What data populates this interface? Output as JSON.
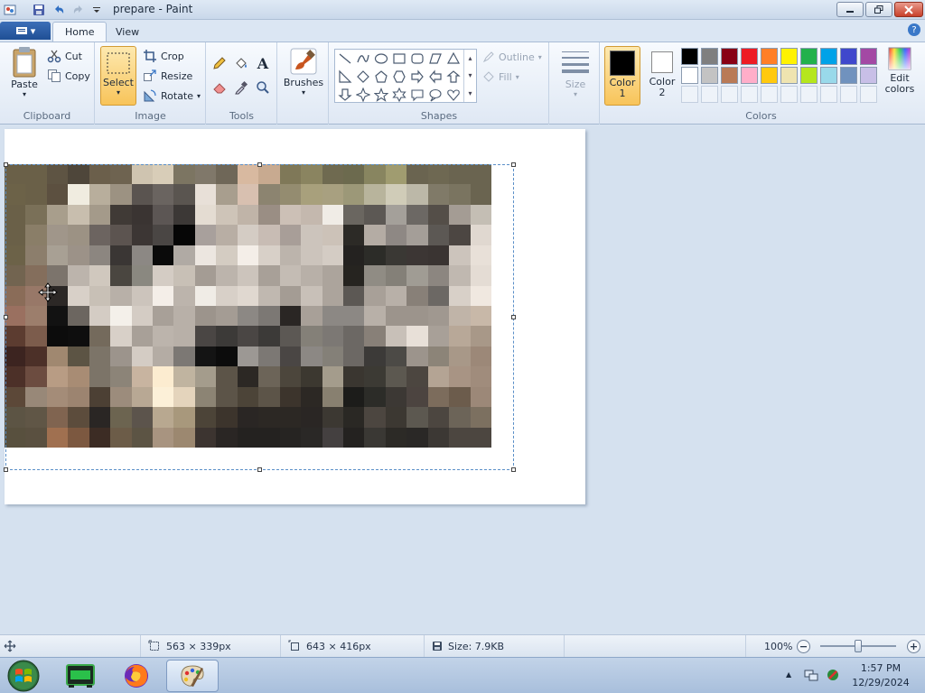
{
  "window": {
    "title": "prepare - Paint"
  },
  "tabs": [
    {
      "label": "Home"
    },
    {
      "label": "View"
    }
  ],
  "clipboard": {
    "paste": "Paste",
    "cut": "Cut",
    "copy": "Copy",
    "label": "Clipboard"
  },
  "image": {
    "select": "Select",
    "crop": "Crop",
    "resize": "Resize",
    "rotate": "Rotate",
    "label": "Image"
  },
  "tools": {
    "label": "Tools"
  },
  "brushes": {
    "label": "Brushes"
  },
  "shapes": {
    "outline": "Outline",
    "fill": "Fill",
    "label": "Shapes"
  },
  "size": {
    "label": "Size"
  },
  "colors": {
    "color1": "Color 1",
    "color2": "Color 2",
    "edit": "Edit colors",
    "label": "Colors",
    "color1_value": "#000000",
    "color2_value": "#ffffff",
    "palette_row1": [
      "#000000",
      "#7f7f7f",
      "#880015",
      "#ed1c24",
      "#ff7f27",
      "#fff200",
      "#22b14c",
      "#00a2e8",
      "#3f48cc",
      "#a349a4"
    ],
    "palette_row2": [
      "#ffffff",
      "#c3c3c3",
      "#b97a57",
      "#ffaec9",
      "#ffc90e",
      "#efe4b0",
      "#b5e61d",
      "#99d9ea",
      "#7092be",
      "#c8bfe7"
    ]
  },
  "status": {
    "selection_size": "563 × 339px",
    "canvas_size": "643 × 416px",
    "file_size": "Size: 7.9KB",
    "zoom": "100%",
    "zoom_level": 0.5
  },
  "taskbar": {
    "time": "1:57 PM",
    "date": "12/29/2024"
  },
  "image_pixels": [
    [
      "#6a6048",
      "#6a6048",
      "#5e5443",
      "#4e463a",
      "#6b5f4b",
      "#6e6350",
      "#cfc4b0",
      "#d8cdb8",
      "#7c7562",
      "#80786a",
      "#6f6758",
      "#d8b9a0",
      "#c8aa90",
      "#7f7858",
      "#8a8460",
      "#6f6a50",
      "#6c6a4e",
      "#888560",
      "#a09c70",
      "#6a6450",
      "#6e6852",
      "#6a6450",
      "#6a6450"
    ],
    [
      "#6c6248",
      "#6a6048",
      "#5c5040",
      "#f0ece0",
      "#b8ae9c",
      "#9c9282",
      "#5a5450",
      "#6a6460",
      "#5a5550",
      "#e8e0d8",
      "#a89e8e",
      "#d8c0b0",
      "#8c8470",
      "#948c70",
      "#a8a07c",
      "#a8a080",
      "#9c9878",
      "#b8b49c",
      "#d0ccb8",
      "#bcb8a8",
      "#807a68",
      "#7a7460",
      "#6a6450"
    ],
    [
      "#6a6048",
      "#7a7058",
      "#a89e8c",
      "#c8beae",
      "#a49a8a",
      "#403a36",
      "#3a3432",
      "#5c5654",
      "#3c3836",
      "#e4dcd2",
      "#cec4b8",
      "#c0b4a8",
      "#9a8e84",
      "#ccc0b6",
      "#c4b8ae",
      "#f0ece6",
      "#6a6660",
      "#5c5854",
      "#a4a09a",
      "#6c6864",
      "#544e48",
      "#a49c94",
      "#c4beb4"
    ],
    [
      "#6a6048",
      "#8a7e68",
      "#a0968a",
      "#9c9284",
      "#6c6460",
      "#5c5450",
      "#3c3634",
      "#4a4644",
      "#060606",
      "#a8a09c",
      "#b8aea4",
      "#d4ccc4",
      "#c8bcb4",
      "#a89e98",
      "#ccc4bc",
      "#ccc2b8",
      "#2c2a26",
      "#b4aca4",
      "#8e8884",
      "#a49e98",
      "#5c5854",
      "#4c4642",
      "#e0d8d0"
    ],
    [
      "#6c6248",
      "#8c7e6c",
      "#a8a094",
      "#9c9288",
      "#8c8680",
      "#3a3634",
      "#8c8884",
      "#0a0a0a",
      "#b0aaa4",
      "#ece6e0",
      "#d4ccc2",
      "#f4eee8",
      "#d8d0c8",
      "#bcb4ac",
      "#ccc4bc",
      "#d4ccc4",
      "#242220",
      "#2c2c28",
      "#3a3834",
      "#3c3634",
      "#3a3432",
      "#ccc4bc",
      "#e8e0d8"
    ],
    [
      "#726450",
      "#846e5c",
      "#7c746c",
      "#bcb4ac",
      "#d0c8be",
      "#4a4640",
      "#8a8880",
      "#d4ccc4",
      "#c8c0b6",
      "#a49c94",
      "#bcb4ac",
      "#ccc4bc",
      "#a8a098",
      "#c4bcb4",
      "#b8b0a8",
      "#aca49c",
      "#262420",
      "#908c84",
      "#848078",
      "#a09c94",
      "#8c8680",
      "#c0b8b0",
      "#e4dcd4"
    ],
    [
      "#8a6c58",
      "#987868",
      "#2c2826",
      "#d8d0c8",
      "#c8c0b6",
      "#b8b0a8",
      "#ccc4bc",
      "#f4eee8",
      "#bcb4ac",
      "#f0ece6",
      "#d8d0c8",
      "#e0d8d0",
      "#c0b8b0",
      "#a49c94",
      "#c8c0b8",
      "#acA49c",
      "#5c5854",
      "#a8a098",
      "#b8b0a8",
      "#888078",
      "#6c6864",
      "#d8d0c8",
      "#f0e8e0"
    ],
    [
      "#9a7060",
      "#9c7e6c",
      "#121212",
      "#6c6660",
      "#d4ccc4",
      "#f4f0ea",
      "#d4ccc4",
      "#a8a098",
      "#b8b0a8",
      "#9c948c",
      "#a49c94",
      "#8c8884",
      "#7c7874",
      "#2a2624",
      "#a8a098",
      "#8c8884",
      "#8c8884",
      "#b8b0a8",
      "#9c948c",
      "#9c948c",
      "#a09890",
      "#c0b4a8",
      "#c8b8a8"
    ],
    [
      "#5c3c30",
      "#7c5c4c",
      "#0c0c0c",
      "#0e0e0e",
      "#746a5c",
      "#d8d0c8",
      "#a8a098",
      "#bcb4ac",
      "#b8b0a8",
      "#4a4644",
      "#3c3a38",
      "#4a4644",
      "#3c3a38",
      "#5c5854",
      "#848078",
      "#7c7874",
      "#6c6864",
      "#888078",
      "#c8c0b8",
      "#e8e0d8",
      "#a8a098",
      "#b8a898",
      "#a89888"
    ],
    [
      "#3c2420",
      "#4c3028",
      "#a08870",
      "#5c5444",
      "#7c7468",
      "#9c948c",
      "#d4ccc4",
      "#b4aca4",
      "#7c7874",
      "#141414",
      "#0c0c0c",
      "#9c9894",
      "#7c7874",
      "#4a4644",
      "#8c8884",
      "#848078",
      "#6c6864",
      "#3c3a38",
      "#4c4a46",
      "#9c948c",
      "#8c8478",
      "#a89888",
      "#9c8878"
    ],
    [
      "#4c3028",
      "#6c4c40",
      "#b89c84",
      "#a88c74",
      "#7c7468",
      "#8c8478",
      "#c8b4a0",
      "#fcecd0",
      "#c0b4a0",
      "#a49c8c",
      "#5c5448",
      "#2c2824",
      "#6c6458",
      "#4c463c",
      "#3c3830",
      "#a49c8c",
      "#3a3630",
      "#3c3a34",
      "#5c5850",
      "#4c4640",
      "#b4a494",
      "#a89484",
      "#a08c7c"
    ],
    [
      "#5c4838",
      "#988878",
      "#a48c78",
      "#9c8470",
      "#4c4034",
      "#9c8c7c",
      "#b8a894",
      "#fcf0d8",
      "#e4d4bc",
      "#8c8474",
      "#5c5448",
      "#4c4438",
      "#5c5448",
      "#3c342c",
      "#2c2824",
      "#888070",
      "#1c1c1a",
      "#2c2c28",
      "#3c3834",
      "#4c4440",
      "#7c6c5c",
      "#6c5c4c",
      "#9c8878"
    ],
    [
      "#5c5444",
      "#605646",
      "#806450",
      "#5c4c3c",
      "#2a2624",
      "#6c6450",
      "#5c544c",
      "#b8a890",
      "#a8987c",
      "#4c4438",
      "#3c342c",
      "#2a2624",
      "#2c2824",
      "#2c2824",
      "#2a2624",
      "#3c3832",
      "#2a2824",
      "#4c4640",
      "#3c3832",
      "#5c5850",
      "#4c4640",
      "#6c6458",
      "#7c7060"
    ],
    [
      "#58503e",
      "#5a5040",
      "#a07050",
      "#7c5840",
      "#3c2c24",
      "#6c5c48",
      "#5c5444",
      "#a89480",
      "#9c8870",
      "#3c3430",
      "#2a2624",
      "#242220",
      "#242220",
      "#262422",
      "#2a2826",
      "#444040",
      "#242220",
      "#3a3834",
      "#2c2a26",
      "#2a2826",
      "#3c3834",
      "#4c4640",
      "#4c4640"
    ]
  ]
}
